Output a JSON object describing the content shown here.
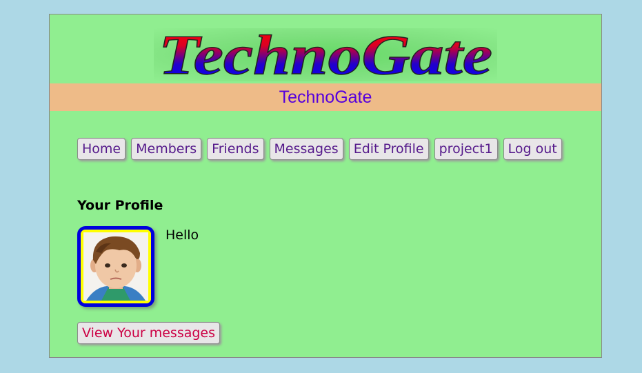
{
  "logo": {
    "text": "TechnoGate"
  },
  "subtitle": "TechnoGate",
  "menu": {
    "items": [
      {
        "label": "Home"
      },
      {
        "label": "Members"
      },
      {
        "label": "Friends"
      },
      {
        "label": "Messages"
      },
      {
        "label": "Edit Profile"
      },
      {
        "label": "project1"
      },
      {
        "label": "Log out"
      }
    ]
  },
  "profile": {
    "heading": "Your Profile",
    "text": "Hello",
    "view_messages_label": "View Your messages"
  },
  "colors": {
    "page_background": "#add8e6",
    "panel_background": "#90ee90",
    "subtitle_band": "#eebb88",
    "subtitle_text": "#5500dd",
    "menu_text": "#551a8b",
    "view_messages_text": "#cc0044",
    "avatar_border": "#0000dd"
  }
}
